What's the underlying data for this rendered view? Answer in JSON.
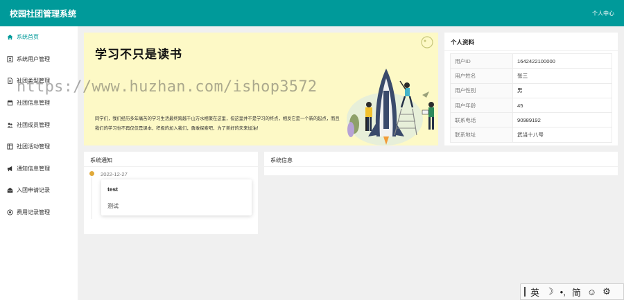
{
  "app": {
    "title": "校园社团管理系统",
    "user_menu": "个人中心"
  },
  "sidebar": {
    "items": [
      {
        "label": "系统首页",
        "icon": "home-icon",
        "active": true
      },
      {
        "label": "系统用户管理",
        "icon": "user-card-icon"
      },
      {
        "label": "社团类型管理",
        "icon": "document-icon"
      },
      {
        "label": "社团信息管理",
        "icon": "calendar-icon"
      },
      {
        "label": "社团成员管理",
        "icon": "users-icon"
      },
      {
        "label": "社团活动管理",
        "icon": "grid-icon"
      },
      {
        "label": "通知信息管理",
        "icon": "megaphone-icon"
      },
      {
        "label": "入团申请记录",
        "icon": "envelope-icon"
      },
      {
        "label": "费用记录管理",
        "icon": "coin-icon"
      }
    ]
  },
  "banner": {
    "title": "学习不只是读书",
    "text": "同学们，我们经历多年痛苦的学习生活最终跨越千山万水相聚在这里，但这里并不是学习的终点，相反它是一个新的起点，而且我们的学习也不再仅仅是课本，积极的加入我们，勇敢探索吧，为了美好的未来加油！"
  },
  "profile": {
    "heading": "个人资料",
    "rows": [
      {
        "key": "用户ID",
        "value": "1642422100000"
      },
      {
        "key": "用户姓名",
        "value": "张三"
      },
      {
        "key": "用户性别",
        "value": "男"
      },
      {
        "key": "用户年龄",
        "value": "45"
      },
      {
        "key": "联系电话",
        "value": "90989192"
      },
      {
        "key": "联系地址",
        "value": "武当十八号"
      }
    ]
  },
  "notice": {
    "heading": "系统通知",
    "date": "2022-12-27",
    "item_title": "test",
    "item_body": "测试"
  },
  "sysinfo": {
    "heading": "系统信息"
  },
  "watermark": "https://www.huzhan.com/ishop3572",
  "ime": {
    "mode": "英",
    "moon": "☽",
    "punct": "•,",
    "script": "简",
    "emoji": "☺",
    "settings": "⚙"
  },
  "colors": {
    "primary": "#009a9a",
    "banner_bg": "#fdf9c6",
    "dot": "#e0a93a"
  }
}
